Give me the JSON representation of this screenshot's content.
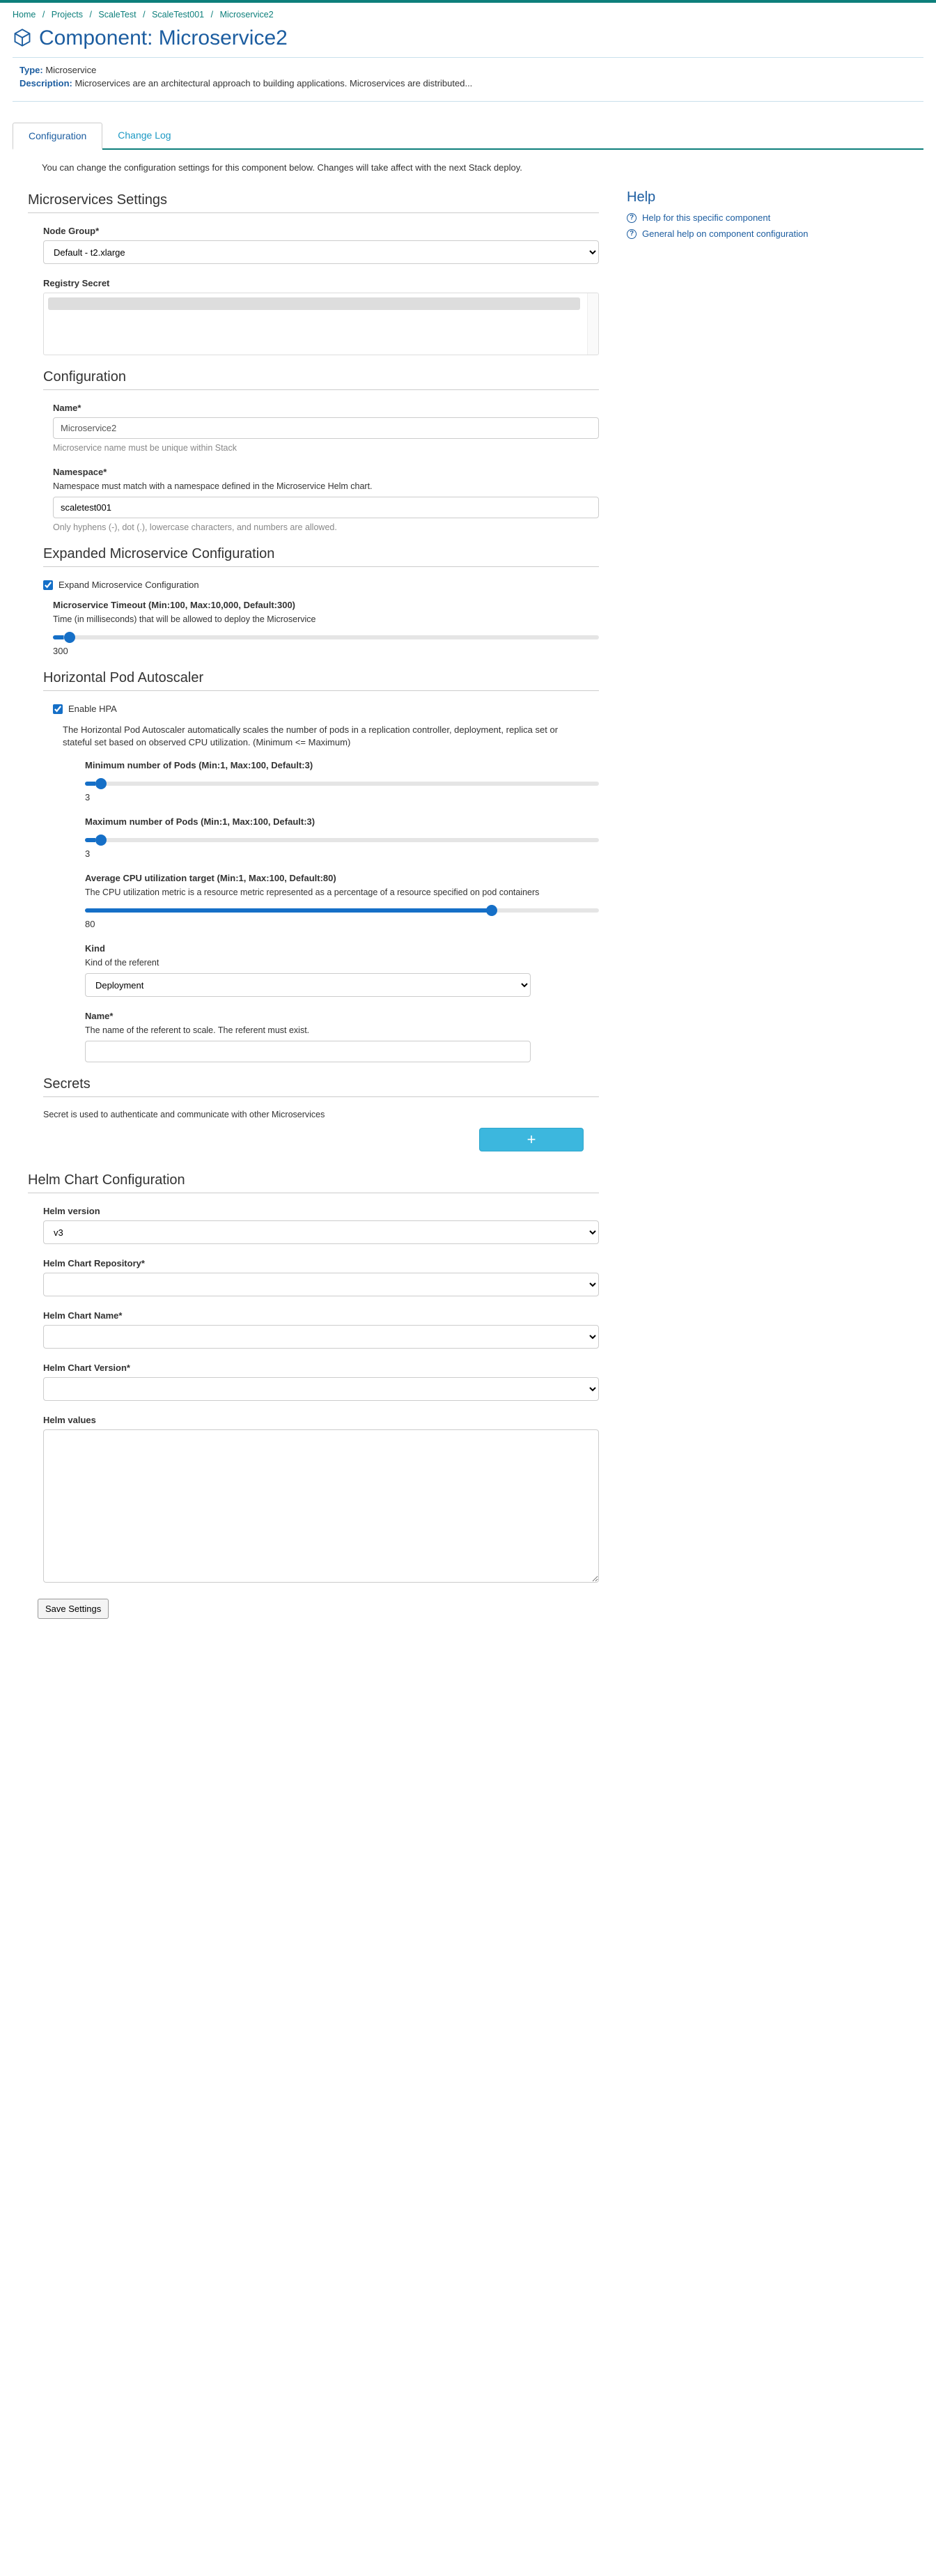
{
  "breadcrumbs": {
    "home": "Home",
    "projects": "Projects",
    "project": "ScaleTest",
    "stack": "ScaleTest001",
    "current": "Microservice2"
  },
  "page_title": "Component: Microservice2",
  "meta": {
    "type_label": "Type:",
    "type_value": "Microservice",
    "desc_label": "Description:",
    "desc_value": "Microservices are an architectural approach to building applications. Microservices are distributed..."
  },
  "tabs": {
    "config": "Configuration",
    "changelog": "Change Log"
  },
  "intro": "You can change the configuration settings for this component below. Changes will take affect with the next Stack deploy.",
  "help": {
    "title": "Help",
    "specific": "Help for this specific component",
    "general": "General help on component configuration"
  },
  "sections": {
    "ms_settings": "Microservices Settings",
    "configuration": "Configuration",
    "expanded": "Expanded Microservice Configuration",
    "hpa": "Horizontal Pod Autoscaler",
    "secrets": "Secrets",
    "helm": "Helm Chart Configuration"
  },
  "fields": {
    "node_group": {
      "label": "Node Group*",
      "value": "Default - t2.xlarge"
    },
    "registry_secret": {
      "label": "Registry Secret"
    },
    "name": {
      "label": "Name*",
      "value": "Microservice2",
      "hint": "Microservice name must be unique within Stack"
    },
    "namespace": {
      "label": "Namespace*",
      "desc": "Namespace must match with a namespace defined in the Microservice Helm chart.",
      "value": "scaletest001",
      "hint": "Only hyphens (-), dot (.), lowercase characters, and numbers are allowed."
    },
    "expand_check": "Expand Microservice Configuration",
    "timeout": {
      "label": "Microservice Timeout (Min:100, Max:10,000, Default:300)",
      "desc": "Time (in milliseconds) that will be allowed to deploy the Microservice",
      "value": "300"
    },
    "enable_hpa": "Enable HPA",
    "hpa_desc": "The Horizontal Pod Autoscaler automatically scales the number of pods in a replication controller, deployment, replica set or stateful set based on observed CPU utilization. (Minimum <= Maximum)",
    "min_pods": {
      "label": "Minimum number of Pods (Min:1, Max:100, Default:3)",
      "value": "3"
    },
    "max_pods": {
      "label": "Maximum number of Pods (Min:1, Max:100, Default:3)",
      "value": "3"
    },
    "cpu_target": {
      "label": "Average CPU utilization target (Min:1, Max:100, Default:80)",
      "desc": "The CPU utilization metric is a resource metric represented as a percentage of a resource specified on pod containers",
      "value": "80"
    },
    "kind": {
      "label": "Kind",
      "desc": "Kind of the referent",
      "value": "Deployment"
    },
    "ref_name": {
      "label": "Name*",
      "desc": "The name of the referent to scale. The referent must exist.",
      "value": ""
    },
    "secrets_desc": "Secret is used to authenticate and communicate with other Microservices",
    "helm_version": {
      "label": "Helm version",
      "value": "v3"
    },
    "helm_repo": {
      "label": "Helm Chart Repository*",
      "value": ""
    },
    "helm_name": {
      "label": "Helm Chart Name*",
      "value": ""
    },
    "helm_chart_version": {
      "label": "Helm Chart Version*",
      "value": ""
    },
    "helm_values": {
      "label": "Helm values",
      "value": ""
    }
  },
  "buttons": {
    "add": "+",
    "save": "Save Settings"
  }
}
